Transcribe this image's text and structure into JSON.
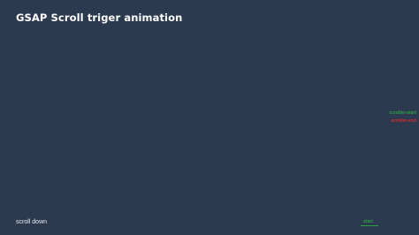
{
  "page": {
    "title": "GSAP Scroll triger animation",
    "scroll_hint": "scroll down"
  },
  "markers": {
    "scroller_start": "scroller-start",
    "scroller_end": "scroller-end",
    "start": "start"
  },
  "colors": {
    "background": "#2c3a50",
    "start_marker": "#2f9e3f",
    "end_marker": "#d62c2c"
  }
}
